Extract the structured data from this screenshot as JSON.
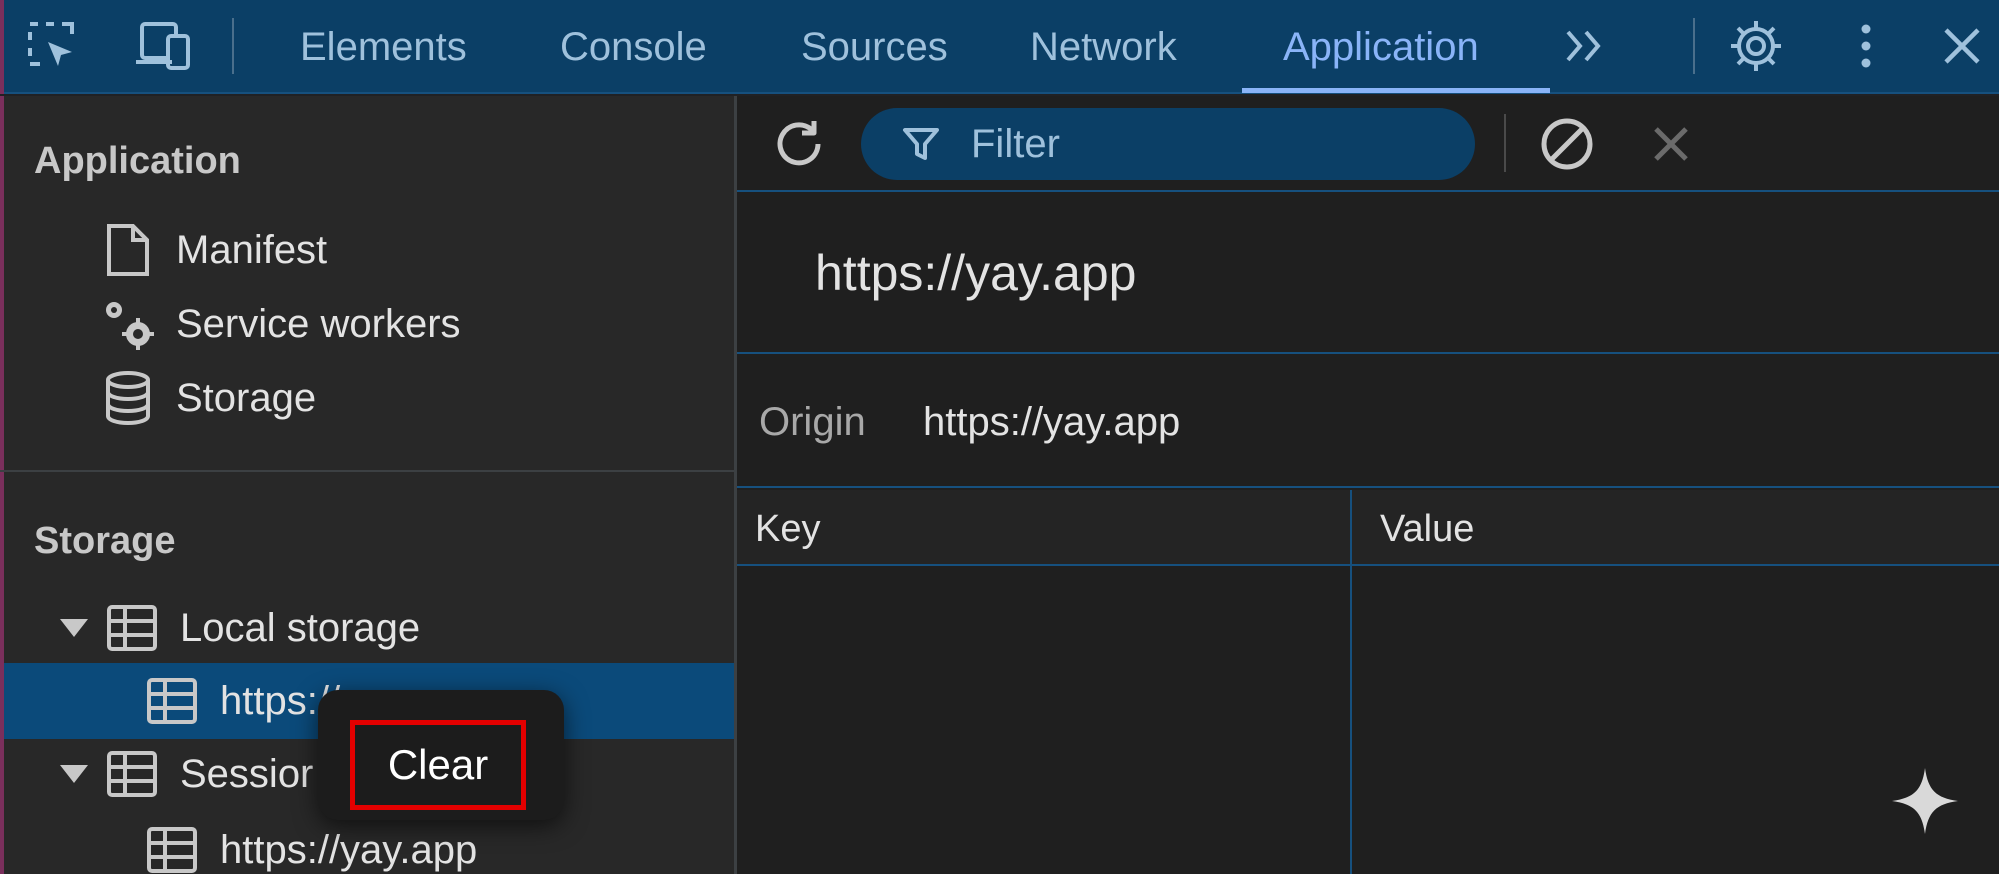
{
  "toolbar": {
    "tabs": [
      {
        "label": "Elements"
      },
      {
        "label": "Console"
      },
      {
        "label": "Sources"
      },
      {
        "label": "Network"
      },
      {
        "label": "Application",
        "active": true
      }
    ],
    "icons": [
      "inspect-element-icon",
      "device-toolbar-icon",
      "more-tabs-icon",
      "settings-icon",
      "more-options-icon",
      "close-icon"
    ]
  },
  "sidebar": {
    "application_section": {
      "title": "Application",
      "items": [
        {
          "label": "Manifest",
          "icon": "document-icon"
        },
        {
          "label": "Service workers",
          "icon": "gears-icon"
        },
        {
          "label": "Storage",
          "icon": "database-icon"
        }
      ]
    },
    "storage_section": {
      "title": "Storage",
      "items": [
        {
          "label": "Local storage",
          "icon": "table-icon",
          "expanded": true
        },
        {
          "label": "https://yay.app",
          "icon": "table-icon",
          "selected": true,
          "visible_text": "https://"
        },
        {
          "label": "Session storage",
          "icon": "table-icon",
          "expanded": true,
          "visible_text": "Sessior"
        },
        {
          "label": "https://yay.app",
          "icon": "table-icon"
        }
      ]
    }
  },
  "context_menu": {
    "items": [
      {
        "label": "Clear",
        "highlighted": true
      }
    ]
  },
  "main": {
    "filter": {
      "placeholder": "Filter"
    },
    "origin_title": "https://yay.app",
    "origin_label": "Origin",
    "origin_value": "https://yay.app",
    "table": {
      "columns": [
        "Key",
        "Value"
      ],
      "rows": []
    }
  },
  "colors": {
    "toolbar_bg": "#0b3f66",
    "accent": "#8ab4f8",
    "selected_bg": "#0b4a7a",
    "highlight_border": "#e30000",
    "panel_bg": "#1f1f1f"
  }
}
